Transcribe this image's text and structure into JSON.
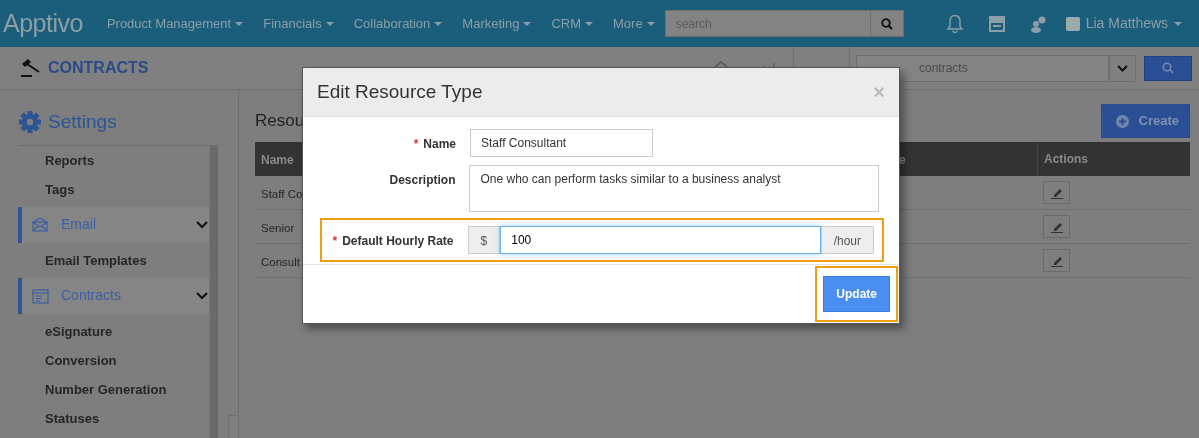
{
  "navbar": {
    "logo": "Apptivo",
    "menus": [
      {
        "label": "Product Management"
      },
      {
        "label": "Financials"
      },
      {
        "label": "Collaboration"
      },
      {
        "label": "Marketing"
      },
      {
        "label": "CRM"
      },
      {
        "label": "More"
      }
    ],
    "search": {
      "placeholder": "search"
    },
    "user": "Lia Matthews"
  },
  "app_header": {
    "title": "CONTRACTS",
    "search": {
      "placeholder": "contracts"
    }
  },
  "sidebar": {
    "title": "Settings",
    "items": [
      {
        "kind": "link",
        "label": "Reports"
      },
      {
        "kind": "link",
        "label": "Tags"
      },
      {
        "kind": "section",
        "label": "Email",
        "expanded": true
      },
      {
        "kind": "link",
        "label": "Email Templates"
      },
      {
        "kind": "section",
        "label": "Contracts",
        "expanded": true
      },
      {
        "kind": "link",
        "label": "eSignature"
      },
      {
        "kind": "link",
        "label": "Conversion"
      },
      {
        "kind": "link",
        "label": "Number Generation"
      },
      {
        "kind": "link",
        "label": "Statuses"
      }
    ]
  },
  "page": {
    "title": "Resou",
    "create_button": "Create",
    "table": {
      "columns": [
        "Name",
        "e",
        "Actions"
      ],
      "rows": [
        {
          "name": "Staff Co"
        },
        {
          "name": "Senior"
        },
        {
          "name": "Consult"
        }
      ]
    }
  },
  "modal": {
    "title": "Edit Resource Type",
    "close_label": "×",
    "fields": [
      {
        "kind": "text",
        "label": "Name",
        "marker": "*",
        "value": "Staff Consultant",
        "highlighted": false
      },
      {
        "kind": "textarea",
        "label": "Description",
        "value": "One who can perform tasks similar to a business analyst",
        "highlighted": false
      },
      {
        "kind": "money",
        "label": "Default Hourly Rate",
        "marker": "*",
        "prefix": "$",
        "value": "100",
        "suffix": "/hour",
        "highlighted": true
      }
    ],
    "update_button": {
      "label": "Update",
      "highlighted": true
    }
  }
}
